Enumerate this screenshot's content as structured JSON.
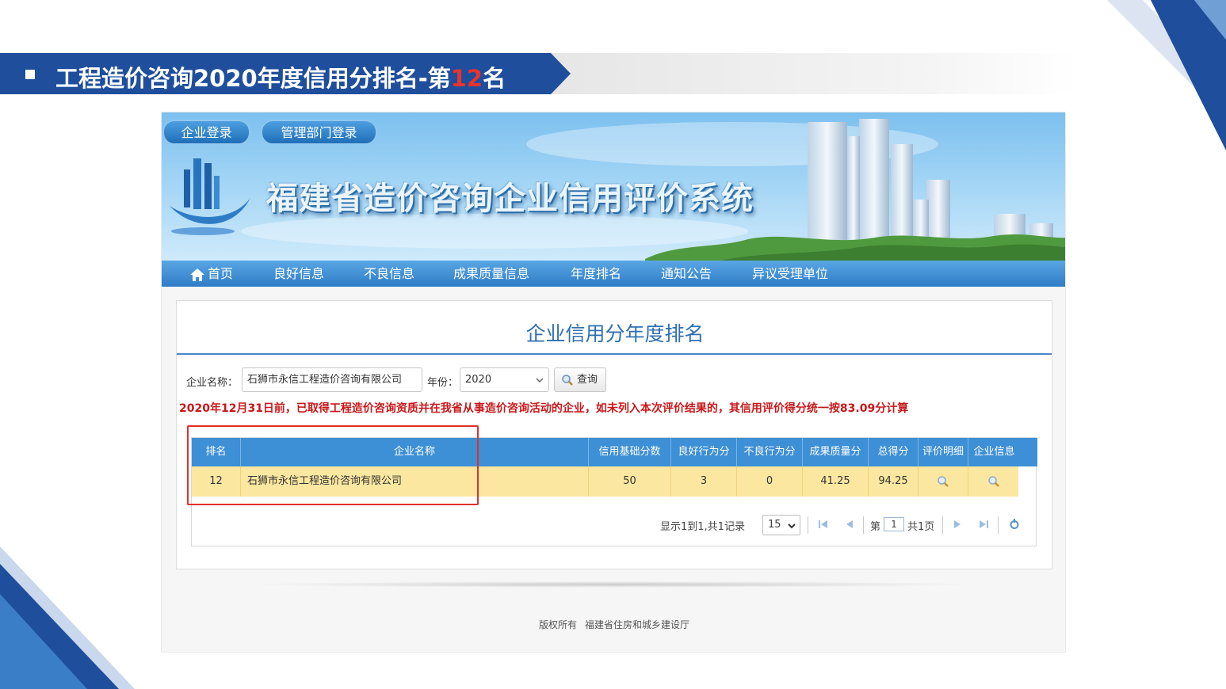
{
  "slide": {
    "title_prefix": "工程造价咨询2020年度信用分排名-第",
    "title_rank": "12",
    "title_suffix": "名",
    "accent_color": "#1f4e9c",
    "highlight_color": "#e8332e"
  },
  "site": {
    "login_buttons": [
      "企业登录",
      "管理部门登录"
    ],
    "banner_title": "福建省造价咨询企业信用评价系统",
    "nav": [
      "首页",
      "良好信息",
      "不良信息",
      "成果质量信息",
      "年度排名",
      "通知公告",
      "异议受理单位"
    ],
    "home_icon": "home-icon"
  },
  "ranking": {
    "page_title": "企业信用分年度排名",
    "company_label": "企业名称：",
    "company_value": "石狮市永信工程造价咨询有限公司",
    "year_label": "年份：",
    "year_value": "2020",
    "query_label": "查询",
    "notice": "2020年12月31日前，已取得工程造价咨询资质并在我省从事造价咨询活动的企业，如未列入本次评价结果的，其信用评价得分统一按83.09分计算",
    "columns": [
      "排名",
      "企业名称",
      "信用基础分数",
      "良好行为分",
      "不良行为分",
      "成果质量分",
      "总得分",
      "评价明细",
      "企业信息"
    ],
    "rows": [
      {
        "rank": "12",
        "company": "石狮市永信工程造价咨询有限公司",
        "base": "50",
        "good": "3",
        "bad": "0",
        "quality": "41.25",
        "total": "94.25"
      }
    ],
    "pager": {
      "summary": "显示1到1,共1记录",
      "page_size": "15",
      "page_prefix": "第",
      "page_current": "1",
      "page_suffix": "共1页"
    }
  },
  "footer": {
    "copyright": "版权所有",
    "owner": "福建省住房和城乡建设厅"
  }
}
